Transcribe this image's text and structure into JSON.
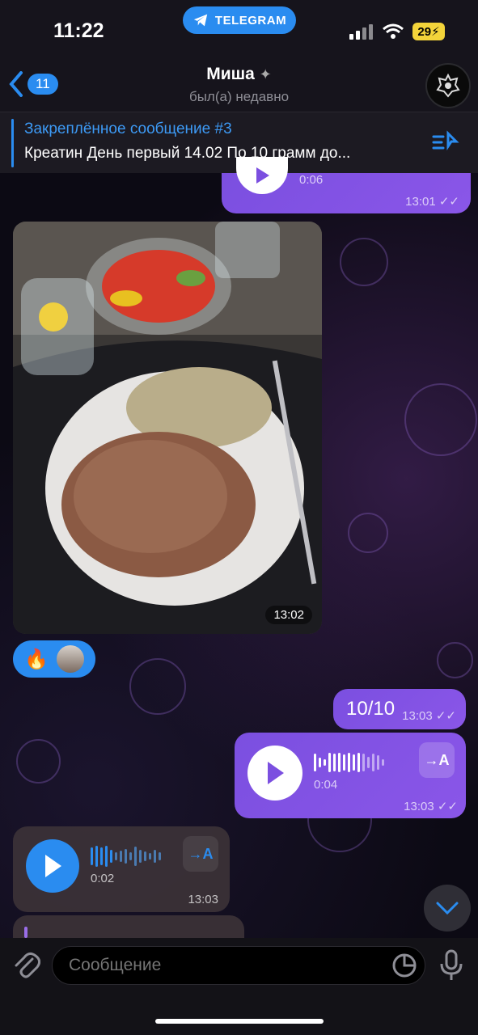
{
  "status_bar": {
    "time": "11:22",
    "app_pill": "TELEGRAM",
    "battery": "29"
  },
  "header": {
    "back_count": "11",
    "name": "Миша",
    "status": "был(а) недавно"
  },
  "pinned": {
    "title": "Закреплённое сообщение #3",
    "text": "Креатин День первый 14.02 По 10 грамм до..."
  },
  "messages": {
    "voice_out_top": {
      "duration": "0:06",
      "time": "13:01"
    },
    "photo": {
      "time": "13:02"
    },
    "reactions": {
      "emoji": "🔥"
    },
    "text_out": {
      "text": "10/10",
      "time": "13:03"
    },
    "voice_out_2": {
      "duration": "0:04",
      "time": "13:03",
      "transcribe": "→A"
    },
    "voice_in": {
      "duration": "0:02",
      "time": "13:03",
      "transcribe": "→A"
    }
  },
  "composer": {
    "placeholder": "Сообщение"
  },
  "colors": {
    "accent": "#2a8cf0",
    "outgoing": "#7b4fe0",
    "incoming": "#3c3237",
    "battery": "#f3d43a"
  }
}
